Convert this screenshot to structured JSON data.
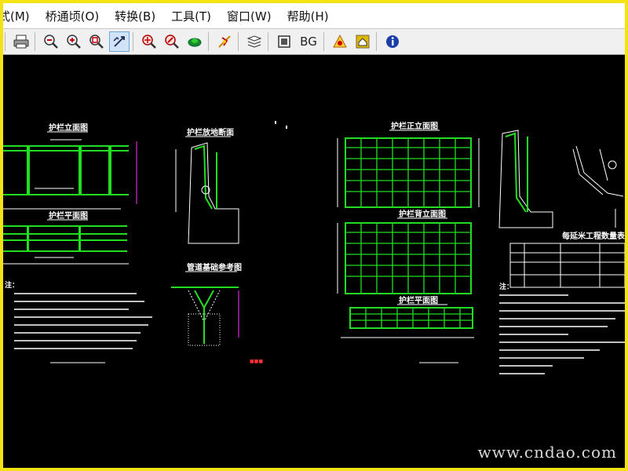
{
  "menu": {
    "items": [
      "式(M)",
      "桥通顷(O)",
      "转换(B)",
      "工具(T)",
      "窗口(W)",
      "帮助(H)"
    ]
  },
  "toolbar": {
    "buttons": [
      {
        "name": "print-icon"
      },
      {
        "name": "zoom-out-icon"
      },
      {
        "name": "zoom-in-icon"
      },
      {
        "name": "zoom-window-icon"
      },
      {
        "name": "pan-icon",
        "active": true
      },
      {
        "name": "zoom-realtime-icon"
      },
      {
        "name": "zoom-extents-icon"
      },
      {
        "name": "view-3d-icon"
      },
      {
        "name": "measure-icon"
      },
      {
        "name": "layers-icon"
      },
      {
        "name": "layout-icon"
      },
      {
        "name": "home-icon"
      },
      {
        "name": "info-icon"
      }
    ],
    "bg_label": "BG"
  },
  "drawing": {
    "titles": {
      "t1": "护栏立面图",
      "t2": "护栏平面图",
      "t3": "护栏放地断面",
      "t4": "管道基础参考图",
      "t5": "护栏正立面图",
      "t6": "护栏背立面图",
      "t7": "护栏平面图",
      "t8": "每延米工程数量表"
    },
    "notes_label": "注："
  },
  "watermark": "www.cndao.com",
  "colors": {
    "frame": "#f5e214",
    "canvas": "#000000",
    "cad_green": "#22dd22",
    "cad_white": "#ffffff",
    "cad_magenta": "#ff33ff"
  }
}
